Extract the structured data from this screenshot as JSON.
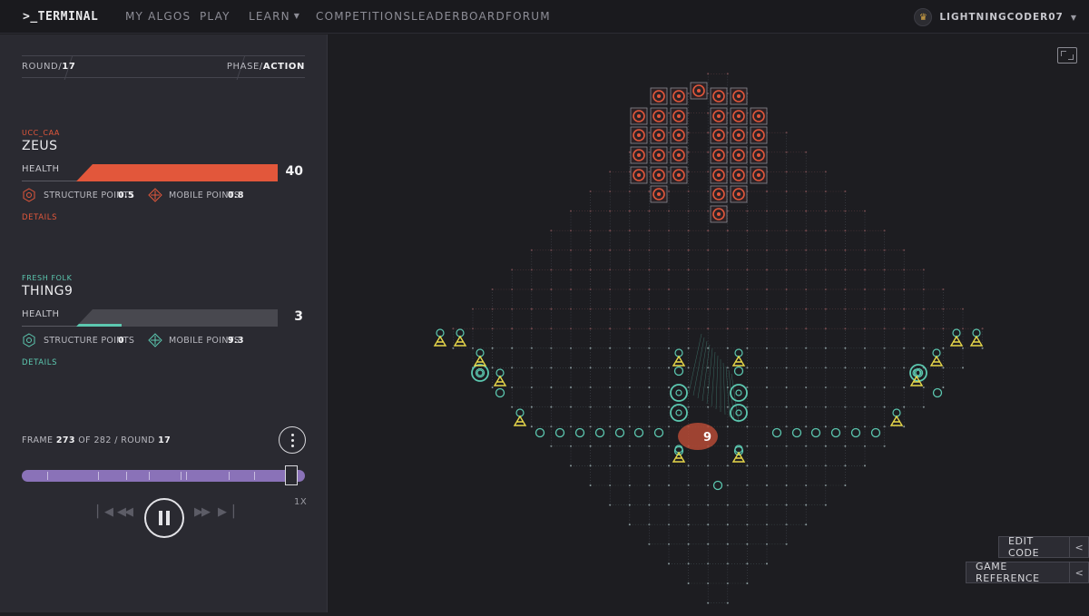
{
  "nav": {
    "logo": ">_TERMINAL",
    "items": [
      "MY ALGOS",
      "PLAY",
      "LEARN",
      "COMPETITIONS",
      "LEADERBOARD",
      "FORUM"
    ],
    "username": "LIGHTNINGCODER07"
  },
  "round": {
    "label": "ROUND/",
    "value": "17",
    "phase_label": "PHASE/",
    "phase_value": "ACTION"
  },
  "players": [
    {
      "team": "UCC_CAA",
      "name": "ZEUS",
      "health_label": "HEALTH",
      "health": "40",
      "health_fraction": 1.0,
      "structure_label": "STRUCTURE POINTS",
      "structure_points": "0.5",
      "mobile_label": "MOBILE POINTS",
      "mobile_points": "0.8",
      "details": "DETAILS",
      "color": "#e2573b"
    },
    {
      "team": "FRESH FOLK",
      "name": "THING9",
      "health_label": "HEALTH",
      "health": "3",
      "health_fraction": 0.075,
      "structure_label": "STRUCTURE POINTS",
      "structure_points": "0",
      "mobile_label": "MOBILE POINTS",
      "mobile_points": "9.3",
      "details": "DETAILS",
      "color": "#5cc8b0"
    }
  ],
  "playback": {
    "frame_label": "FRAME",
    "frame": "273",
    "of_label": "OF",
    "total": "282",
    "round_label": "/ ROUND",
    "round": "17",
    "speed": "1X",
    "progress": 0.968
  },
  "board": {
    "damage_number": "9"
  },
  "buttons": {
    "edit_code": "EDIT CODE",
    "game_reference": "GAME REFERENCE"
  },
  "colors": {
    "accent_red": "#e2573b",
    "accent_teal": "#5cc8b0",
    "scrubber": "#8a72b8",
    "encryptor_yellow": "#e8d84a"
  }
}
